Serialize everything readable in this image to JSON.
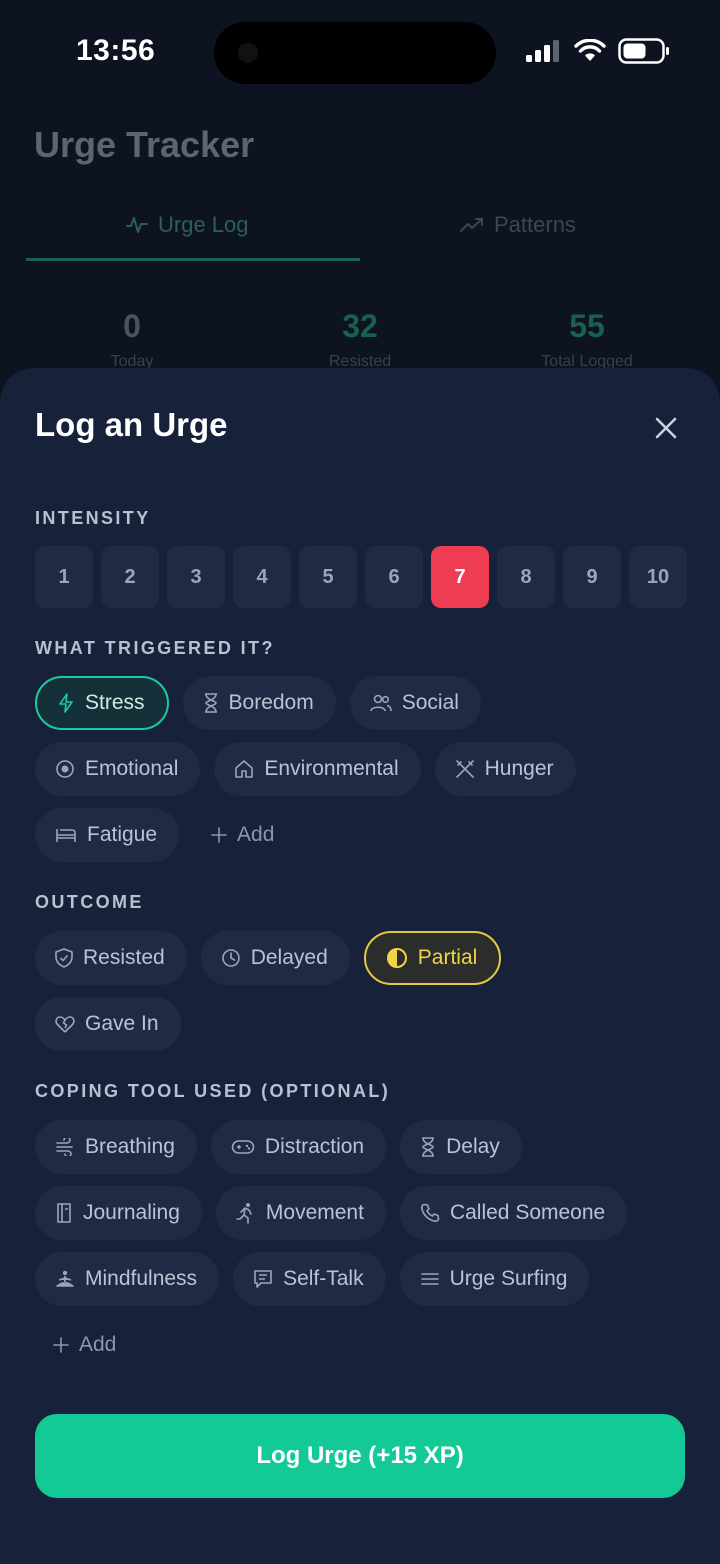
{
  "status_bar": {
    "time": "13:56"
  },
  "background": {
    "title": "Urge Tracker",
    "tabs": [
      {
        "label": "Urge Log"
      },
      {
        "label": "Patterns"
      }
    ],
    "stats": [
      {
        "value": "0",
        "label": "Today"
      },
      {
        "value": "32",
        "label": "Resisted"
      },
      {
        "value": "55",
        "label": "Total Logged"
      }
    ]
  },
  "sheet": {
    "title": "Log an Urge",
    "intensity": {
      "label": "INTENSITY",
      "levels": [
        "1",
        "2",
        "3",
        "4",
        "5",
        "6",
        "7",
        "8",
        "9",
        "10"
      ],
      "selected": "7"
    },
    "triggers": {
      "label": "WHAT TRIGGERED IT?",
      "items": [
        "Stress",
        "Boredom",
        "Social",
        "Emotional",
        "Environmental",
        "Hunger",
        "Fatigue"
      ],
      "add_label": "Add",
      "selected": "Stress"
    },
    "outcome": {
      "label": "OUTCOME",
      "items": [
        "Resisted",
        "Delayed",
        "Partial",
        "Gave In"
      ],
      "selected": "Partial"
    },
    "coping": {
      "label": "COPING TOOL USED (OPTIONAL)",
      "items": [
        "Breathing",
        "Distraction",
        "Delay",
        "Journaling",
        "Movement",
        "Called Someone",
        "Mindfulness",
        "Self-Talk",
        "Urge Surfing"
      ],
      "add_label": "Add"
    },
    "submit_label": "Log Urge (+15 XP)"
  },
  "colors": {
    "accent": "#13c995",
    "selected_intensity": "#ee3c52",
    "partial": "#e4c93d",
    "sheet_bg": "#17223a"
  }
}
